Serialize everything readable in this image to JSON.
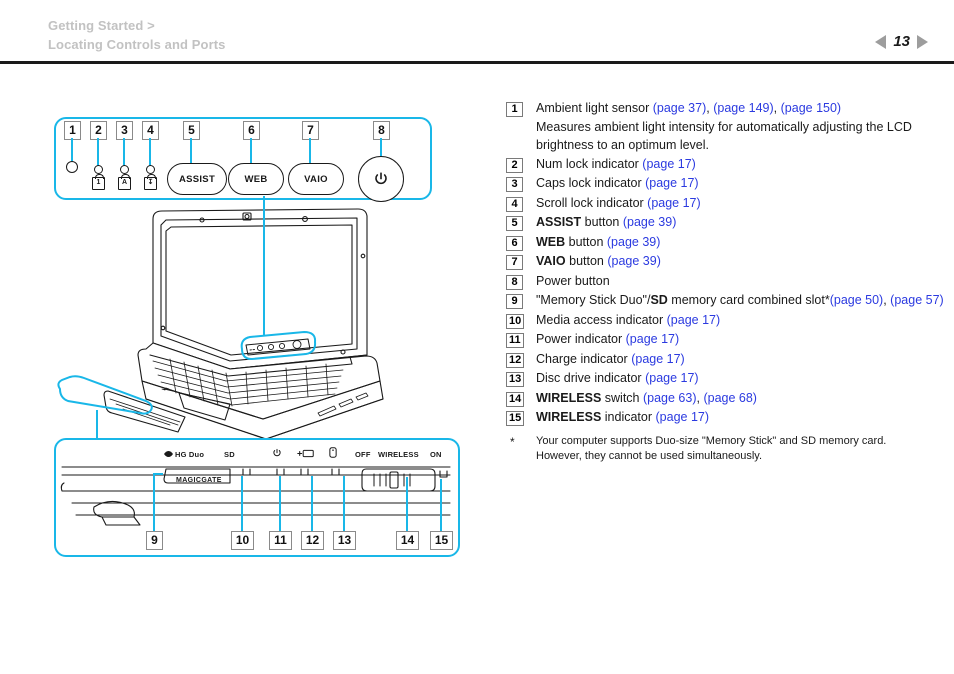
{
  "header": {
    "breadcrumb_line1": "Getting Started >",
    "breadcrumb_line2": "Locating Controls and Ports",
    "page_number": "13",
    "prev_icon": "triangle-left-icon",
    "next_icon": "triangle-right-icon"
  },
  "items": [
    {
      "num": "1",
      "label": "Ambient light sensor ",
      "links": [
        "(page 37)",
        "(page 149)",
        "(page 150)"
      ],
      "description": "Measures ambient light intensity for automatically adjusting the LCD brightness to an optimum level."
    },
    {
      "num": "2",
      "label": "Num lock indicator ",
      "links": [
        "(page 17)"
      ]
    },
    {
      "num": "3",
      "label": "Caps lock indicator ",
      "links": [
        "(page 17)"
      ]
    },
    {
      "num": "4",
      "label": "Scroll lock indicator ",
      "links": [
        "(page 17)"
      ]
    },
    {
      "num": "5",
      "bold": "ASSIST",
      "label": " button ",
      "links": [
        "(page 39)"
      ]
    },
    {
      "num": "6",
      "bold": "WEB",
      "label": " button ",
      "links": [
        "(page 39)"
      ]
    },
    {
      "num": "7",
      "bold": "VAIO",
      "label": " button ",
      "links": [
        "(page 39)"
      ]
    },
    {
      "num": "8",
      "label": "Power button",
      "links": []
    },
    {
      "num": "9",
      "label": "\"Memory Stick Duo\"/",
      "bold_mid": "SD",
      "label2": " memory card combined slot*",
      "links": [
        "(page 50)",
        "(page 57)"
      ]
    },
    {
      "num": "10",
      "label": "Media access indicator ",
      "links": [
        "(page 17)"
      ]
    },
    {
      "num": "11",
      "label": "Power indicator ",
      "links": [
        "(page 17)"
      ]
    },
    {
      "num": "12",
      "label": "Charge indicator ",
      "links": [
        "(page 17)"
      ]
    },
    {
      "num": "13",
      "label": "Disc drive indicator ",
      "links": [
        "(page 17)"
      ]
    },
    {
      "num": "14",
      "bold": "WIRELESS",
      "label": " switch ",
      "links": [
        "(page 63)",
        "(page 68)"
      ]
    },
    {
      "num": "15",
      "bold": "WIRELESS",
      "label": " indicator ",
      "links": [
        "(page 17)"
      ]
    }
  ],
  "footnote": {
    "marker": "*",
    "line1": "Your computer supports Duo-size \"Memory Stick\" and SD memory card.",
    "line2": "However, they cannot be used simultaneously."
  },
  "figure": {
    "top_panel": {
      "callouts": [
        "1",
        "2",
        "3",
        "4",
        "5",
        "6",
        "7",
        "8"
      ],
      "buttons": [
        {
          "name": "assist-button",
          "label": "ASSIST"
        },
        {
          "name": "web-button",
          "label": "WEB"
        },
        {
          "name": "vaio-button",
          "label": "VAIO"
        }
      ],
      "power_icon": "power-symbol-icon",
      "indicators": [
        {
          "name": "ambient-light-sensor",
          "glyph": "circle"
        },
        {
          "name": "num-lock-indicator",
          "glyph": "lock-1"
        },
        {
          "name": "caps-lock-indicator",
          "glyph": "lock-A"
        },
        {
          "name": "scroll-lock-indicator",
          "glyph": "lock-arrow"
        }
      ]
    },
    "bottom_panel": {
      "callouts": [
        "9",
        "10",
        "11",
        "12",
        "13",
        "14",
        "15"
      ],
      "labels": {
        "memory_stick": "HG Duo",
        "sd": "SD",
        "magicgate": "MAGICGATE",
        "off": "OFF",
        "wireless": "WIRELESS",
        "on": "ON"
      },
      "icons": [
        "memory-stick-icon",
        "power-indicator-icon",
        "charge-indicator-icon",
        "disc-drive-indicator-icon"
      ]
    },
    "laptop_illustration": "vaio-laptop-line-drawing"
  },
  "colors": {
    "callout_cyan": "#19b7e8",
    "link_blue": "#2b3ae0",
    "header_gray": "#c2c2c2",
    "text_black": "#1a1a1a"
  }
}
